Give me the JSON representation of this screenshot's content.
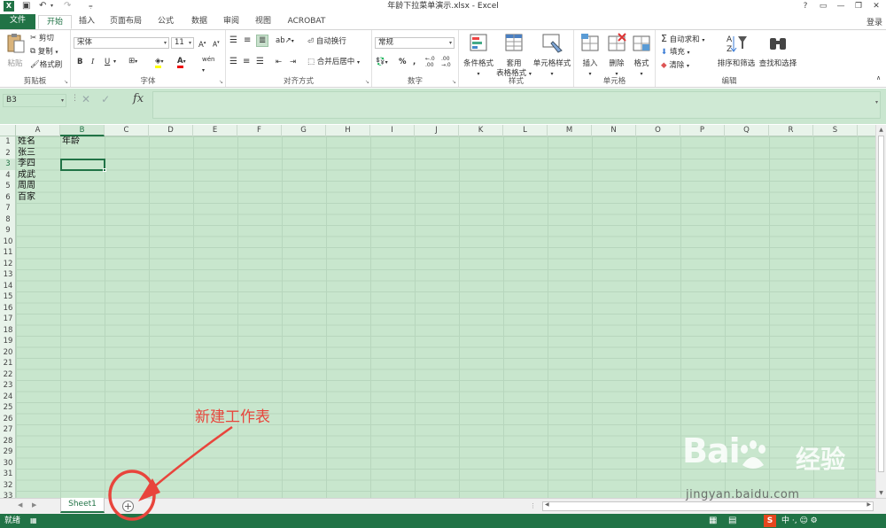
{
  "window": {
    "title": "年龄下拉菜单演示.xlsx - Excel",
    "app_icon": "X",
    "controls": [
      "?",
      "▭",
      "—",
      "❐",
      "✕"
    ]
  },
  "tabs": [
    "文件",
    "开始",
    "插入",
    "页面布局",
    "公式",
    "数据",
    "审阅",
    "视图",
    "ACROBAT"
  ],
  "login": "登录",
  "ribbon": {
    "clipboard": {
      "paste": "粘贴",
      "cut": "剪切",
      "copy": "复制",
      "format_painter": "格式刷",
      "label": "剪贴板"
    },
    "font": {
      "name": "宋体",
      "size": "11",
      "bold": "B",
      "italic": "I",
      "underline": "U",
      "label": "字体"
    },
    "alignment": {
      "wrap": "自动换行",
      "merge": "合并后居中",
      "label": "对齐方式"
    },
    "number": {
      "format": "常规",
      "percent": "%",
      "comma": ",",
      "label": "数字"
    },
    "styles": {
      "conditional": "条件格式",
      "table_1": "套用",
      "table_2": "表格格式",
      "cell_styles": "单元格样式",
      "label": "样式"
    },
    "cells": {
      "insert": "插入",
      "delete": "删除",
      "format": "格式",
      "label": "单元格"
    },
    "editing": {
      "autosum": "自动求和",
      "fill": "填充",
      "clear": "清除",
      "sort": "排序和筛选",
      "find": "查找和选择",
      "label": "编辑"
    }
  },
  "formula_bar": {
    "name_box": "B3",
    "fx": "fx",
    "value": ""
  },
  "sheet": {
    "columns": [
      "A",
      "B",
      "C",
      "D",
      "E",
      "F",
      "G",
      "H",
      "I",
      "J",
      "K",
      "L",
      "M",
      "N",
      "O",
      "P",
      "Q",
      "R",
      "S"
    ],
    "rows": [
      "1",
      "2",
      "3",
      "4",
      "5",
      "6",
      "7",
      "8",
      "9",
      "10",
      "11",
      "12",
      "13",
      "14",
      "15",
      "16",
      "17",
      "18",
      "19",
      "20",
      "21",
      "22",
      "23",
      "24",
      "25",
      "26",
      "27",
      "28",
      "29",
      "30",
      "31",
      "32",
      "33"
    ],
    "selected_cell": "B3",
    "cells": {
      "A1": "姓名",
      "B1": "年龄",
      "A2": "张三",
      "A3": "李四",
      "A4": "成武",
      "A5": "周周",
      "A6": "百家"
    }
  },
  "sheet_tabs": {
    "active": "Sheet1",
    "add": "+"
  },
  "status": {
    "ready": "就绪",
    "right": "中 ·, ☺ ⚙"
  },
  "annotation": {
    "text": "新建工作表"
  },
  "watermark": {
    "brand": "Bai",
    "brand_cn": "经验",
    "url": "jingyan.baidu.com"
  }
}
